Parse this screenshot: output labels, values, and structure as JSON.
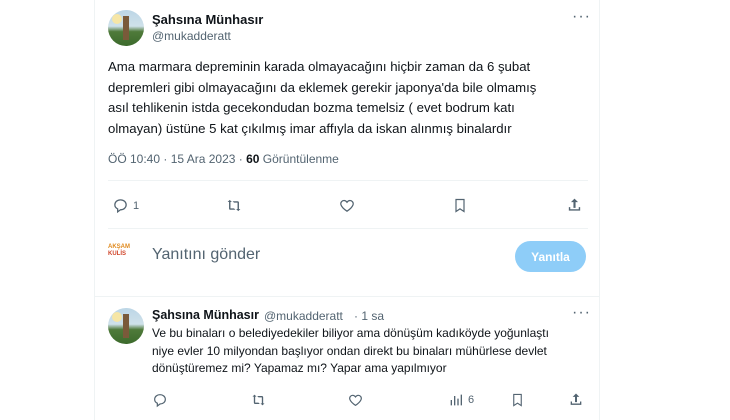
{
  "main_tweet": {
    "author_name": "Şahsına Münhasır",
    "author_handle": "@mukadderatt",
    "more": "···",
    "text": "Ama marmara depreminin karada olmayacağını hiçbir zaman da 6 şubat\ndepremleri gibi olmayacağını da eklemek gerekir japonya'da bile olmamış\nasıl tehlikenin istda gecekondudan bozma temelsiz ( evet bodrum katı\nolmayan) üstüne 5 kat çıkılmış imar affıyla da iskan alınmış binalardır",
    "time": "ÖÖ 10:40 · 15 Ara 2023 · ",
    "views_count": "60",
    "views_label": " Görüntülenme",
    "reply_count": "1"
  },
  "reply_box": {
    "avatar_top": "AKŞAM",
    "avatar_bottom": "KULİS",
    "placeholder": "Yanıtını gönder",
    "button": "Yanıtla"
  },
  "reply_tweet": {
    "author_name": "Şahsına Münhasır",
    "author_handle": "@mukadderatt",
    "time": "· 1 sa",
    "more": "···",
    "text": "Ve bu binaları o belediyedekiler biliyor ama dönüşüm kadıköyde yoğunlaştı\nniye evler 10 milyondan başlıyor ondan direkt bu binaları mühürlese devlet\ndönüştüremez mi? Yapamaz mı? Yapar ama yapılmıyor",
    "views_count": "6"
  },
  "colors": {
    "accent": "#1d9bf0",
    "button_disabled": "#8ecdf8",
    "secondary_text": "#536471"
  }
}
